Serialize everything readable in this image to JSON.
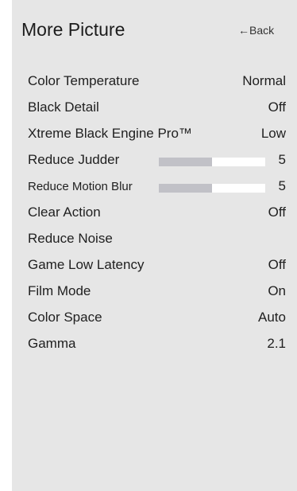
{
  "header": {
    "title": "More Picture",
    "back_label": "←Back"
  },
  "menu": {
    "items": [
      {
        "label": "Color Temperature",
        "value": "Normal"
      },
      {
        "label": "Black Detail",
        "value": "Off"
      },
      {
        "label": "Xtreme Black Engine Pro™",
        "value": "Low"
      },
      {
        "label": "Reduce Judder",
        "value": "5",
        "level": 0.5
      },
      {
        "label": "Reduce Motion Blur",
        "value": "5",
        "level": 0.5
      },
      {
        "label": "Clear Action",
        "value": "Off"
      },
      {
        "label": "Reduce Noise",
        "value": ""
      },
      {
        "label": "Game Low Latency",
        "value": "Off"
      },
      {
        "label": "Film Mode",
        "value": "On"
      },
      {
        "label": "Color Space",
        "value": "Auto"
      },
      {
        "label": "Gamma",
        "value": "2.1"
      }
    ]
  }
}
